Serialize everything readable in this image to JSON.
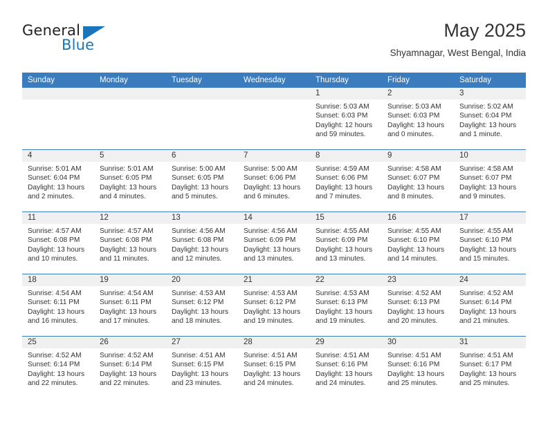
{
  "logo": {
    "line1": "General",
    "line2": "Blue",
    "triangle_icon": "triangle-icon",
    "color_dark": "#231f20",
    "color_blue": "#1b75bb"
  },
  "header": {
    "title": "May 2025",
    "subtitle": "Shyamnagar, West Bengal, India"
  },
  "theme": {
    "header_bg": "#3b7cbf",
    "daynum_bg": "#f0f0f0",
    "text": "#333333",
    "page_bg": "#ffffff"
  },
  "calendar": {
    "weekday_headers": [
      "Sunday",
      "Monday",
      "Tuesday",
      "Wednesday",
      "Thursday",
      "Friday",
      "Saturday"
    ],
    "weeks": [
      [
        {
          "day": "",
          "sunrise": "",
          "sunset": "",
          "daylight": "",
          "daylight2": "",
          "empty": true
        },
        {
          "day": "",
          "sunrise": "",
          "sunset": "",
          "daylight": "",
          "daylight2": "",
          "empty": true
        },
        {
          "day": "",
          "sunrise": "",
          "sunset": "",
          "daylight": "",
          "daylight2": "",
          "empty": true
        },
        {
          "day": "",
          "sunrise": "",
          "sunset": "",
          "daylight": "",
          "daylight2": "",
          "empty": true
        },
        {
          "day": "1",
          "sunrise": "Sunrise: 5:03 AM",
          "sunset": "Sunset: 6:03 PM",
          "daylight": "Daylight: 12 hours",
          "daylight2": "and 59 minutes."
        },
        {
          "day": "2",
          "sunrise": "Sunrise: 5:03 AM",
          "sunset": "Sunset: 6:03 PM",
          "daylight": "Daylight: 13 hours",
          "daylight2": "and 0 minutes."
        },
        {
          "day": "3",
          "sunrise": "Sunrise: 5:02 AM",
          "sunset": "Sunset: 6:04 PM",
          "daylight": "Daylight: 13 hours",
          "daylight2": "and 1 minute."
        }
      ],
      [
        {
          "day": "4",
          "sunrise": "Sunrise: 5:01 AM",
          "sunset": "Sunset: 6:04 PM",
          "daylight": "Daylight: 13 hours",
          "daylight2": "and 2 minutes."
        },
        {
          "day": "5",
          "sunrise": "Sunrise: 5:01 AM",
          "sunset": "Sunset: 6:05 PM",
          "daylight": "Daylight: 13 hours",
          "daylight2": "and 4 minutes."
        },
        {
          "day": "6",
          "sunrise": "Sunrise: 5:00 AM",
          "sunset": "Sunset: 6:05 PM",
          "daylight": "Daylight: 13 hours",
          "daylight2": "and 5 minutes."
        },
        {
          "day": "7",
          "sunrise": "Sunrise: 5:00 AM",
          "sunset": "Sunset: 6:06 PM",
          "daylight": "Daylight: 13 hours",
          "daylight2": "and 6 minutes."
        },
        {
          "day": "8",
          "sunrise": "Sunrise: 4:59 AM",
          "sunset": "Sunset: 6:06 PM",
          "daylight": "Daylight: 13 hours",
          "daylight2": "and 7 minutes."
        },
        {
          "day": "9",
          "sunrise": "Sunrise: 4:58 AM",
          "sunset": "Sunset: 6:07 PM",
          "daylight": "Daylight: 13 hours",
          "daylight2": "and 8 minutes."
        },
        {
          "day": "10",
          "sunrise": "Sunrise: 4:58 AM",
          "sunset": "Sunset: 6:07 PM",
          "daylight": "Daylight: 13 hours",
          "daylight2": "and 9 minutes."
        }
      ],
      [
        {
          "day": "11",
          "sunrise": "Sunrise: 4:57 AM",
          "sunset": "Sunset: 6:08 PM",
          "daylight": "Daylight: 13 hours",
          "daylight2": "and 10 minutes."
        },
        {
          "day": "12",
          "sunrise": "Sunrise: 4:57 AM",
          "sunset": "Sunset: 6:08 PM",
          "daylight": "Daylight: 13 hours",
          "daylight2": "and 11 minutes."
        },
        {
          "day": "13",
          "sunrise": "Sunrise: 4:56 AM",
          "sunset": "Sunset: 6:08 PM",
          "daylight": "Daylight: 13 hours",
          "daylight2": "and 12 minutes."
        },
        {
          "day": "14",
          "sunrise": "Sunrise: 4:56 AM",
          "sunset": "Sunset: 6:09 PM",
          "daylight": "Daylight: 13 hours",
          "daylight2": "and 13 minutes."
        },
        {
          "day": "15",
          "sunrise": "Sunrise: 4:55 AM",
          "sunset": "Sunset: 6:09 PM",
          "daylight": "Daylight: 13 hours",
          "daylight2": "and 13 minutes."
        },
        {
          "day": "16",
          "sunrise": "Sunrise: 4:55 AM",
          "sunset": "Sunset: 6:10 PM",
          "daylight": "Daylight: 13 hours",
          "daylight2": "and 14 minutes."
        },
        {
          "day": "17",
          "sunrise": "Sunrise: 4:55 AM",
          "sunset": "Sunset: 6:10 PM",
          "daylight": "Daylight: 13 hours",
          "daylight2": "and 15 minutes."
        }
      ],
      [
        {
          "day": "18",
          "sunrise": "Sunrise: 4:54 AM",
          "sunset": "Sunset: 6:11 PM",
          "daylight": "Daylight: 13 hours",
          "daylight2": "and 16 minutes."
        },
        {
          "day": "19",
          "sunrise": "Sunrise: 4:54 AM",
          "sunset": "Sunset: 6:11 PM",
          "daylight": "Daylight: 13 hours",
          "daylight2": "and 17 minutes."
        },
        {
          "day": "20",
          "sunrise": "Sunrise: 4:53 AM",
          "sunset": "Sunset: 6:12 PM",
          "daylight": "Daylight: 13 hours",
          "daylight2": "and 18 minutes."
        },
        {
          "day": "21",
          "sunrise": "Sunrise: 4:53 AM",
          "sunset": "Sunset: 6:12 PM",
          "daylight": "Daylight: 13 hours",
          "daylight2": "and 19 minutes."
        },
        {
          "day": "22",
          "sunrise": "Sunrise: 4:53 AM",
          "sunset": "Sunset: 6:13 PM",
          "daylight": "Daylight: 13 hours",
          "daylight2": "and 19 minutes."
        },
        {
          "day": "23",
          "sunrise": "Sunrise: 4:52 AM",
          "sunset": "Sunset: 6:13 PM",
          "daylight": "Daylight: 13 hours",
          "daylight2": "and 20 minutes."
        },
        {
          "day": "24",
          "sunrise": "Sunrise: 4:52 AM",
          "sunset": "Sunset: 6:14 PM",
          "daylight": "Daylight: 13 hours",
          "daylight2": "and 21 minutes."
        }
      ],
      [
        {
          "day": "25",
          "sunrise": "Sunrise: 4:52 AM",
          "sunset": "Sunset: 6:14 PM",
          "daylight": "Daylight: 13 hours",
          "daylight2": "and 22 minutes."
        },
        {
          "day": "26",
          "sunrise": "Sunrise: 4:52 AM",
          "sunset": "Sunset: 6:14 PM",
          "daylight": "Daylight: 13 hours",
          "daylight2": "and 22 minutes."
        },
        {
          "day": "27",
          "sunrise": "Sunrise: 4:51 AM",
          "sunset": "Sunset: 6:15 PM",
          "daylight": "Daylight: 13 hours",
          "daylight2": "and 23 minutes."
        },
        {
          "day": "28",
          "sunrise": "Sunrise: 4:51 AM",
          "sunset": "Sunset: 6:15 PM",
          "daylight": "Daylight: 13 hours",
          "daylight2": "and 24 minutes."
        },
        {
          "day": "29",
          "sunrise": "Sunrise: 4:51 AM",
          "sunset": "Sunset: 6:16 PM",
          "daylight": "Daylight: 13 hours",
          "daylight2": "and 24 minutes."
        },
        {
          "day": "30",
          "sunrise": "Sunrise: 4:51 AM",
          "sunset": "Sunset: 6:16 PM",
          "daylight": "Daylight: 13 hours",
          "daylight2": "and 25 minutes."
        },
        {
          "day": "31",
          "sunrise": "Sunrise: 4:51 AM",
          "sunset": "Sunset: 6:17 PM",
          "daylight": "Daylight: 13 hours",
          "daylight2": "and 25 minutes."
        }
      ]
    ]
  }
}
